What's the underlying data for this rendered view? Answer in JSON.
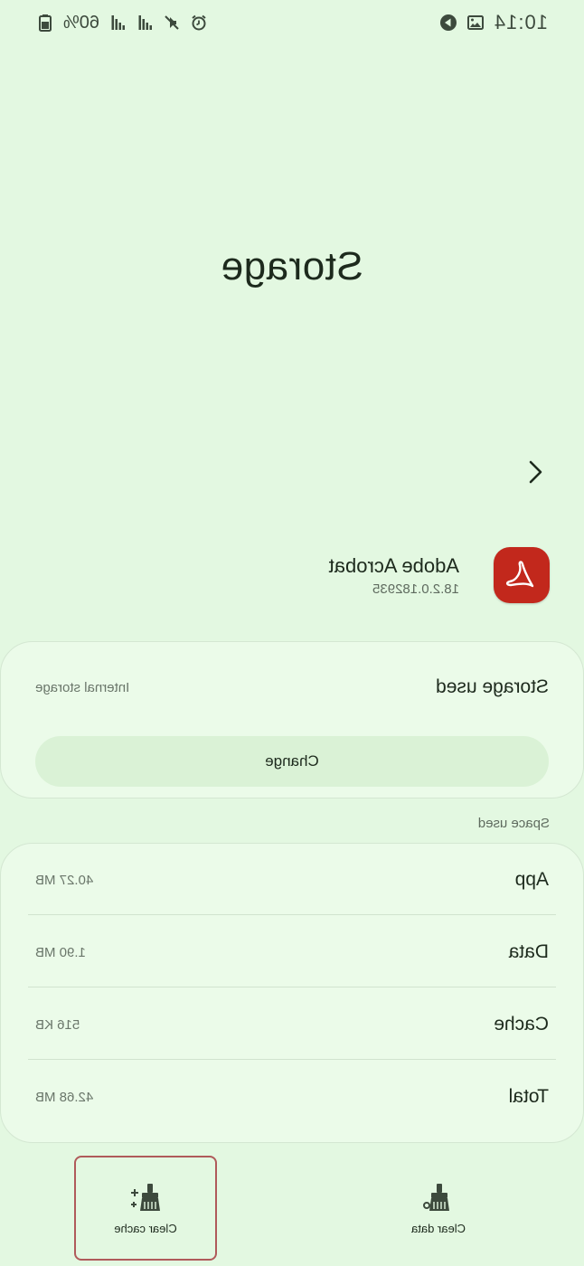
{
  "status_bar": {
    "time": "10:14",
    "battery": "60%"
  },
  "page": {
    "title": "Storage"
  },
  "app": {
    "name": "Adobe Acrobat",
    "version": "18.2.0.182935",
    "icon_color": "#c2281c"
  },
  "storage_used": {
    "label": "Storage used",
    "value": "Internal storage",
    "change_label": "Change"
  },
  "space_used": {
    "section_label": "Space used",
    "rows": [
      {
        "label": "App",
        "value": "40.27 MB"
      },
      {
        "label": "Data",
        "value": "1.90 MB"
      },
      {
        "label": "Cache",
        "value": "516 KB"
      },
      {
        "label": "Total",
        "value": "42.68 MB"
      }
    ]
  },
  "actions": {
    "clear_data": "Clear data",
    "clear_cache": "Clear cache"
  }
}
